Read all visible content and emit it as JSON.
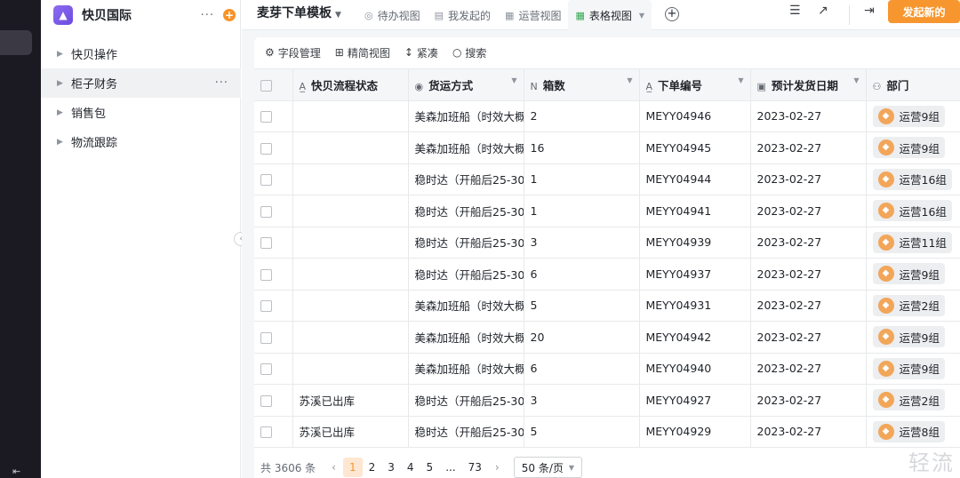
{
  "sidebar": {
    "app_title": "快贝国际",
    "more": "···",
    "add": "+",
    "items": [
      {
        "label": "快贝操作",
        "active": false
      },
      {
        "label": "柜子财务",
        "active": true
      },
      {
        "label": "销售包",
        "active": false
      },
      {
        "label": "物流跟踪",
        "active": false
      }
    ]
  },
  "header": {
    "doc_title": "麦芽下单模板",
    "tabs": [
      {
        "label": "待办视图",
        "icon": "todo-icon"
      },
      {
        "label": "我发起的",
        "icon": "form-icon"
      },
      {
        "label": "运营视图",
        "icon": "grid-icon"
      },
      {
        "label": "表格视图",
        "icon": "table-icon",
        "active": true
      }
    ],
    "primary_button": "发起新的",
    "accent_color": "#f7962f"
  },
  "toolbar": {
    "fields": "字段管理",
    "simple_view": "精简视图",
    "compact": "紧凑",
    "search": "搜索"
  },
  "table": {
    "columns": [
      "快贝流程状态",
      "货运方式",
      "箱数",
      "下单编号",
      "预计发货日期",
      "部门"
    ],
    "rows": [
      {
        "status": "",
        "shipping": "美森加班船（时效大概",
        "boxes": "2",
        "order": "MEYY04946",
        "date": "2023-02-27",
        "dept": "运营9组"
      },
      {
        "status": "",
        "shipping": "美森加班船（时效大概",
        "boxes": "16",
        "order": "MEYY04945",
        "date": "2023-02-27",
        "dept": "运营9组"
      },
      {
        "status": "",
        "shipping": "稳时达（开船后25-30",
        "boxes": "1",
        "order": "MEYY04944",
        "date": "2023-02-27",
        "dept": "运营16组"
      },
      {
        "status": "",
        "shipping": "稳时达（开船后25-30",
        "boxes": "1",
        "order": "MEYY04941",
        "date": "2023-02-27",
        "dept": "运营16组"
      },
      {
        "status": "",
        "shipping": "稳时达（开船后25-30",
        "boxes": "3",
        "order": "MEYY04939",
        "date": "2023-02-27",
        "dept": "运营11组"
      },
      {
        "status": "",
        "shipping": "稳时达（开船后25-30",
        "boxes": "6",
        "order": "MEYY04937",
        "date": "2023-02-27",
        "dept": "运营9组"
      },
      {
        "status": "",
        "shipping": "美森加班船（时效大概",
        "boxes": "5",
        "order": "MEYY04931",
        "date": "2023-02-27",
        "dept": "运营2组"
      },
      {
        "status": "",
        "shipping": "美森加班船（时效大概",
        "boxes": "20",
        "order": "MEYY04942",
        "date": "2023-02-27",
        "dept": "运营9组"
      },
      {
        "status": "",
        "shipping": "美森加班船（时效大概",
        "boxes": "6",
        "order": "MEYY04940",
        "date": "2023-02-27",
        "dept": "运营9组"
      },
      {
        "status": "苏溪已出库",
        "shipping": "稳时达（开船后25-30",
        "boxes": "3",
        "order": "MEYY04927",
        "date": "2023-02-27",
        "dept": "运营2组"
      },
      {
        "status": "苏溪已出库",
        "shipping": "稳时达（开船后25-30",
        "boxes": "5",
        "order": "MEYY04929",
        "date": "2023-02-27",
        "dept": "运营8组"
      }
    ]
  },
  "footer": {
    "total": "共 3606 条",
    "pages": [
      "1",
      "2",
      "3",
      "4",
      "5",
      "...",
      "73"
    ],
    "current_page": "1",
    "page_size": "50 条/页"
  },
  "watermark": "轻流"
}
